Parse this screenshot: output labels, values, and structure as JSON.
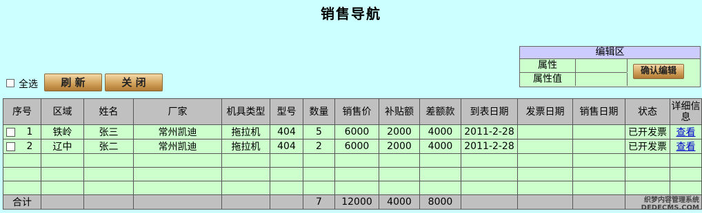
{
  "title": "销售导航",
  "edit": {
    "head": "编辑区",
    "attr_label": "属性",
    "attr_value_label": "属性值",
    "confirm_button": "确认编辑"
  },
  "toolbar": {
    "select_all": "全选",
    "refresh": "刷 新",
    "close": "关 闭"
  },
  "table": {
    "headers": [
      "序号",
      "区域",
      "姓名",
      "厂家",
      "机具类型",
      "型号",
      "数量",
      "销售价",
      "补贴额",
      "差额款",
      "到表日期",
      "发票日期",
      "销售日期",
      "状态",
      "详细信息"
    ],
    "rows": [
      {
        "no": "1",
        "area": "铁岭",
        "name": "张三",
        "maker": "常州凯迪",
        "type": "拖拉机",
        "model": "404",
        "qty": "5",
        "price": "6000",
        "subsidy": "2000",
        "diff": "4000",
        "arrive": "2011-2-28",
        "invoice": "",
        "sale": "",
        "status": "已开发票",
        "detail": "查看"
      },
      {
        "no": "2",
        "area": "辽中",
        "name": "张二",
        "maker": "常州凯迪",
        "type": "拖拉机",
        "model": "404",
        "qty": "2",
        "price": "6000",
        "subsidy": "2000",
        "diff": "4000",
        "arrive": "2011-2-28",
        "invoice": "",
        "sale": "",
        "status": "已开发票",
        "detail": "查看"
      }
    ],
    "total": {
      "label": "合计",
      "qty": "7",
      "price": "12000",
      "subsidy": "4000",
      "diff": "8000"
    }
  },
  "watermark": {
    "line1": "织梦内容管理系统",
    "line2": "DEDECMS.COM"
  }
}
